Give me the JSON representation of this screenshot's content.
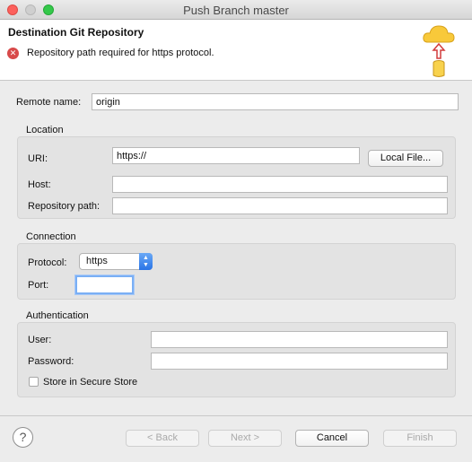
{
  "window": {
    "title": "Push Branch master"
  },
  "banner": {
    "title": "Destination Git Repository",
    "error_message": "Repository path required for https protocol.",
    "error_icon": "error-icon",
    "wizard_icon": "cloud-upload-repository-icon"
  },
  "remote_name": {
    "label": "Remote name:",
    "value": "origin"
  },
  "location": {
    "title": "Location",
    "uri_label": "URI:",
    "uri_value": "https://",
    "local_file_button": "Local File...",
    "host_label": "Host:",
    "host_value": "",
    "repo_path_label": "Repository path:",
    "repo_path_value": ""
  },
  "connection": {
    "title": "Connection",
    "protocol_label": "Protocol:",
    "protocol_value": "https",
    "port_label": "Port:",
    "port_value": ""
  },
  "authentication": {
    "title": "Authentication",
    "user_label": "User:",
    "user_value": "",
    "password_label": "Password:",
    "password_value": "",
    "secure_store_label": "Store in Secure Store",
    "secure_store_checked": false
  },
  "footer": {
    "help_icon": "help-icon",
    "back_label": "< Back",
    "next_label": "Next >",
    "cancel_label": "Cancel",
    "finish_label": "Finish"
  }
}
